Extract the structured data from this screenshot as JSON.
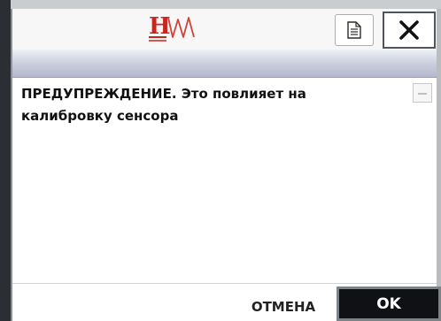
{
  "header": {
    "logo": {
      "letter": "H",
      "icon_name": "hw-logo-icon",
      "letter_color": "#c8261e",
      "wave_color": "#d1433a"
    },
    "document_button": {
      "icon_name": "document-icon"
    },
    "close_button": {
      "icon_name": "close-icon"
    }
  },
  "title_bar": {
    "text": ""
  },
  "message": {
    "text": "ПРЕДУПРЕЖДЕНИЕ. Это повлияет на калибровку сенсора"
  },
  "scrollbar": {
    "icon_name": "scroll-up-icon"
  },
  "footer": {
    "cancel_label": "ОТМЕНА",
    "ok_label": "OK"
  },
  "colors": {
    "ok_background": "#0f1114",
    "title_bar_gradient_top": "#eef0f6",
    "title_bar_gradient_bottom": "#b4b8cc"
  }
}
